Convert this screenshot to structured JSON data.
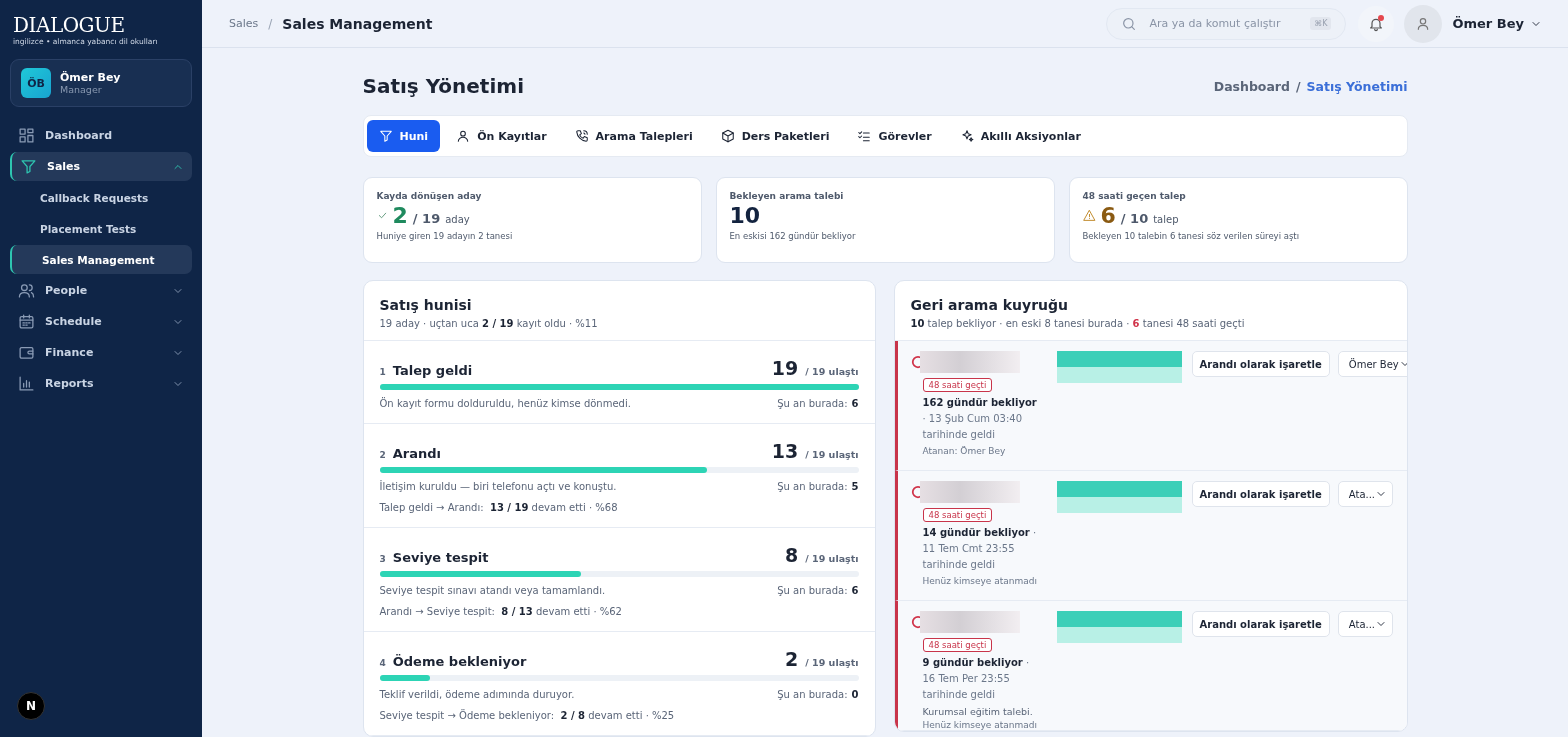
{
  "sidebar": {
    "logo": {
      "title": "DIALOGUE",
      "subtitle": "ingilizce • almanca yabancı dil okulları"
    },
    "user": {
      "initials": "ÖB",
      "name": "Ömer Bey",
      "role": "Manager"
    },
    "nav": [
      {
        "label": "Dashboard",
        "selected": false
      },
      {
        "label": "Sales",
        "selected": true,
        "expanded": true,
        "children": [
          {
            "label": "Callback Requests",
            "selected": false
          },
          {
            "label": "Placement Tests",
            "selected": false
          },
          {
            "label": "Sales Management",
            "selected": true
          }
        ]
      },
      {
        "label": "People",
        "selected": false,
        "expanded": false
      },
      {
        "label": "Schedule",
        "selected": false,
        "expanded": false
      },
      {
        "label": "Finance",
        "selected": false,
        "expanded": false
      },
      {
        "label": "Reports",
        "selected": false,
        "expanded": false
      }
    ],
    "dev_badge": "N"
  },
  "topbar": {
    "breadcrumb": [
      "Sales",
      "Sales Management"
    ],
    "breadcrumb_separator": "/",
    "search": {
      "placeholder": "Ara ya da komut çalıştır",
      "shortcut": "⌘K"
    },
    "notifications": {
      "unread": true
    },
    "user": "Ömer Bey"
  },
  "page": {
    "title": "Satış Yönetimi",
    "breadcrumb": [
      "Dashboard",
      "Satış Yönetimi"
    ],
    "breadcrumb_separator": "/"
  },
  "tabs": [
    {
      "label": "Huni",
      "selected": true
    },
    {
      "label": "Ön Kayıtlar",
      "selected": false
    },
    {
      "label": "Arama Talepleri",
      "selected": false
    },
    {
      "label": "Ders Paketleri",
      "selected": false
    },
    {
      "label": "Görevler",
      "selected": false
    },
    {
      "label": "Akıllı Aksiyonlar",
      "selected": false
    }
  ],
  "stats": [
    {
      "kind": "success",
      "label": "Kayda dönüşen aday",
      "value": "2",
      "total": "/ 19",
      "unit": "aday",
      "note": "Huniye giren 19 adayın 2 tanesi"
    },
    {
      "kind": "neutral",
      "label": "Bekleyen arama talebi",
      "value": "10",
      "note": "En eskisi 162 gündür bekliyor"
    },
    {
      "kind": "warning",
      "label": "48 saati geçen talep",
      "value": "6",
      "total": "/ 10",
      "unit": "talep",
      "note": "Bekleyen 10 talebin 6 tanesi söz verilen süreyi aştı"
    }
  ],
  "funnel": {
    "title": "Satış hunisi",
    "summary": "19 aday · uçtan uca **2 / 19** kayıt oldu · %11",
    "stages": [
      {
        "number": "1",
        "name": "Talep geldi",
        "count": "19",
        "reach": "/ 19 ulaştı",
        "level": 1,
        "description": "Ön kayıt formu dolduruldu, henüz kimse dönmedi.",
        "here_label": "Şu an burada:",
        "here_count": "6"
      },
      {
        "number": "2",
        "name": "Arandı",
        "count": "13",
        "reach": "/ 19 ulaştı",
        "level": 0.684,
        "description": "İletişim kuruldu — biri telefonu açtı ve konuştu.",
        "here_label": "Şu an burada:",
        "here_count": "5",
        "conversion": "Talep geldi → Arandı:  **13 / 19** devam etti · %68"
      },
      {
        "number": "3",
        "name": "Seviye tespit",
        "count": "8",
        "reach": "/ 19 ulaştı",
        "level": 0.421,
        "description": "Seviye tespit sınavı atandı veya tamamlandı.",
        "here_label": "Şu an burada:",
        "here_count": "6",
        "conversion": "Arandı → Seviye tespit:  **8 / 13** devam etti · %62"
      },
      {
        "number": "4",
        "name": "Ödeme bekleniyor",
        "count": "2",
        "reach": "/ 19 ulaştı",
        "level": 0.105,
        "description": "Teklif verildi, ödeme adımında duruyor.",
        "here_label": "Şu an burada:",
        "here_count": "0",
        "conversion": "Seviye tespit → Ödeme bekleniyor:  **2 / 8** devam etti · %25"
      }
    ]
  },
  "queue": {
    "title": "Geri arama kuyruğu",
    "waiting_count": "10",
    "waiting_text": "talep bekliyor · en eski 8 tanesi burada ·",
    "overdue_count": "6",
    "overdue_text": "tanesi 48 saati geçti",
    "items": [
      {
        "overdue": true,
        "badge": "48 saati geçti",
        "waiting": "162 gündür bekliyor",
        "arrived": "· 13 Şub Cum 03:40 tarihinde geldi",
        "assignee": "Atanan: Ömer Bey",
        "action": "Arandı olarak işaretle",
        "assign_value": "Ömer Bey"
      },
      {
        "overdue": true,
        "badge": "48 saati geçti",
        "waiting": "14 gündür bekliyor",
        "arrived": "· 11 Tem Cmt 23:55 tarihinde geldi",
        "assignee": "Henüz kimseye atanmadı",
        "action": "Arandı olarak işaretle",
        "assign_value": "Ata..."
      },
      {
        "overdue": true,
        "badge": "48 saati geçti",
        "waiting": "9 gündür bekliyor",
        "arrived": "· 16 Tem Per 23:55 tarihinde geldi",
        "note": "Kurumsal eğitim talebi.",
        "assignee": "Henüz kimseye atanmadı",
        "action": "Arandı olarak işaretle",
        "assign_value": "Ata..."
      }
    ]
  }
}
